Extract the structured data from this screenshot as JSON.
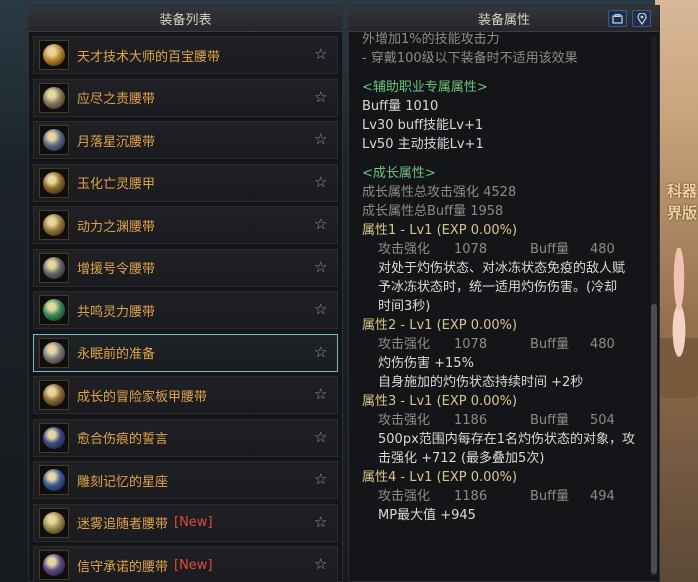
{
  "left_panel": {
    "title": "装备列表",
    "items": [
      {
        "name": "天才技术大师的百宝腰带",
        "new": "",
        "color": "#b8862a"
      },
      {
        "name": "应尽之责腰带",
        "new": "",
        "color": "#8a7a5a"
      },
      {
        "name": "月落星沉腰带",
        "new": "",
        "color": "#5a6a8a"
      },
      {
        "name": "玉化亡灵腰甲",
        "new": "",
        "color": "#8a6a2a"
      },
      {
        "name": "动力之渊腰带",
        "new": "",
        "color": "#9a7a3a"
      },
      {
        "name": "增援号令腰带",
        "new": "",
        "color": "#6a6a6a"
      },
      {
        "name": "共鸣灵力腰带",
        "new": "",
        "color": "#3a8a5a"
      },
      {
        "name": "永眠前的准备",
        "new": "",
        "color": "#7a7a7a"
      },
      {
        "name": "成长的冒险家板甲腰带",
        "new": "",
        "color": "#8a6a3a"
      },
      {
        "name": "愈合伤痕的誓言",
        "new": "",
        "color": "#3a4a8a"
      },
      {
        "name": "雕刻记忆的星座",
        "new": "",
        "color": "#3a5a9a"
      },
      {
        "name": "迷雾追随者腰带",
        "new": "[New]",
        "color": "#9a8a4a"
      },
      {
        "name": "信守承诺的腰带",
        "new": "[New]",
        "color": "#5a4a8a"
      }
    ],
    "star_icon": "☆"
  },
  "right_panel": {
    "title": "装备属性",
    "buttons": [
      "folder-icon",
      "pin-icon"
    ],
    "lines_top": [
      "外增加1%的技能攻击力",
      "- 穿戴100级以下装备时不适用该效果"
    ],
    "section_support": "<辅助职业专属属性>",
    "support_lines": [
      "Buff量  1010",
      "Lv30 buff技能Lv+1",
      "Lv50 主动技能Lv+1"
    ],
    "section_growth": "<成长属性>",
    "growth_lines": [
      "成长属性总攻击强化 4528",
      "成长属性总Buff量 1958"
    ],
    "attributes": [
      {
        "title": "属性1 - Lv1 (EXP 0.00%)",
        "atk_label": "攻击强化",
        "atk": "1078",
        "buff_label": "Buff量",
        "buff": "480",
        "desc": [
          "对处于灼伤状态、对冰冻状态免疫的敌人赋",
          "予冰冻状态时，统一适用灼伤伤害。(冷却",
          "时间3秒)"
        ]
      },
      {
        "title": "属性2 - Lv1 (EXP 0.00%)",
        "atk_label": "攻击强化",
        "atk": "1078",
        "buff_label": "Buff量",
        "buff": "480",
        "desc": [
          "灼伤伤害 +15%",
          "自身施加的灼伤状态持续时间 +2秒"
        ]
      },
      {
        "title": "属性3 - Lv1 (EXP 0.00%)",
        "atk_label": "攻击强化",
        "atk": "1186",
        "buff_label": "Buff量",
        "buff": "504",
        "desc": [
          "500px范围内每存在1名灼伤状态的对象，攻",
          "击强化 +712 (最多叠加5次)"
        ]
      },
      {
        "title": "属性4 - Lv1 (EXP 0.00%)",
        "atk_label": "攻击强化",
        "atk": "1186",
        "buff_label": "Buff量",
        "buff": "494",
        "desc": [
          "MP最大值 +945"
        ]
      }
    ]
  },
  "background": {
    "title_art": [
      "科器",
      "界版"
    ]
  }
}
